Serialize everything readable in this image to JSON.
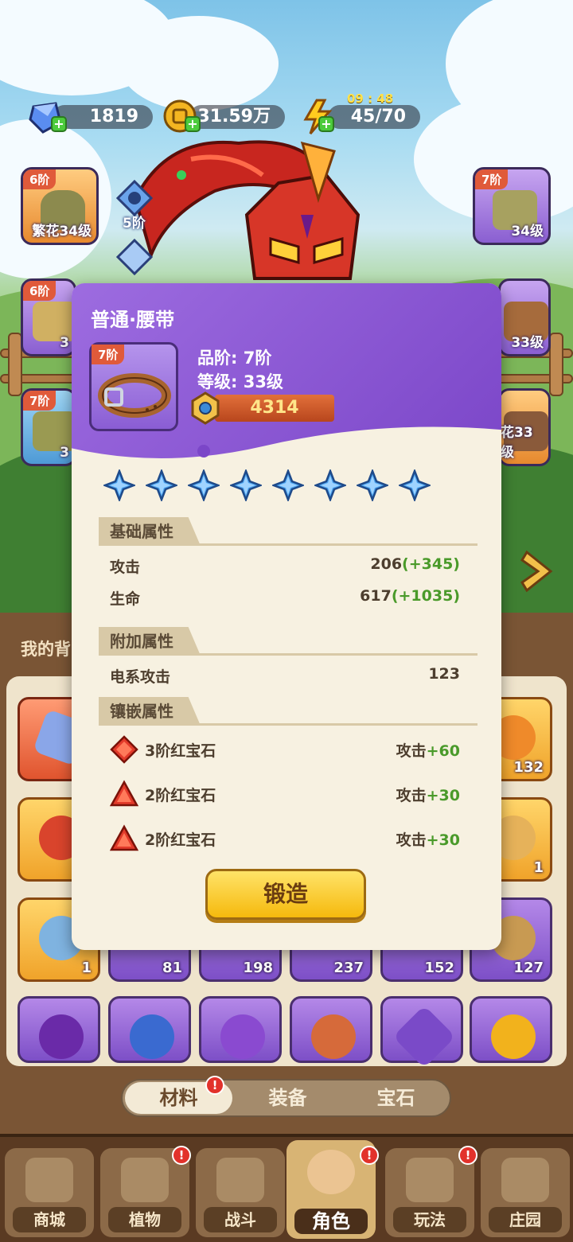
{
  "resources": {
    "diamonds": "1819",
    "gold": "31.59万",
    "energy": "45/70",
    "energy_timer": "09 : 48"
  },
  "equipment_slots": {
    "left_top": {
      "tier": "6阶",
      "level": "繁花34级"
    },
    "left_mid": {
      "tier": "6阶",
      "level": "3"
    },
    "left_bot": {
      "tier": "7阶",
      "level": "3"
    },
    "right_top": {
      "tier": "7阶",
      "level": "34级"
    },
    "right_mid": {
      "tier": "",
      "level": "33级"
    },
    "right_bot": {
      "tier": "",
      "level": "花33级"
    },
    "side_gem_level": "5阶"
  },
  "bag": {
    "title": "我的背",
    "counts": [
      "132",
      "1",
      "1",
      "81",
      "198",
      "237",
      "152",
      "127"
    ]
  },
  "tabs": [
    {
      "label": "材料",
      "badge": "!"
    },
    {
      "label": "装备",
      "badge": ""
    },
    {
      "label": "宝石",
      "badge": ""
    }
  ],
  "nav": [
    {
      "label": "商城",
      "badge": ""
    },
    {
      "label": "植物",
      "badge": "!"
    },
    {
      "label": "战斗",
      "badge": ""
    },
    {
      "label": "角色",
      "badge": "!"
    },
    {
      "label": "玩法",
      "badge": "!"
    },
    {
      "label": "庄园",
      "badge": ""
    }
  ],
  "popup": {
    "title": "普通·腰带",
    "tier_badge": "7阶",
    "quality_line": "品阶: 7阶",
    "level_line": "等级: 33级",
    "power": "4314",
    "star_count": 8,
    "base_section": "基础属性",
    "base_stats": [
      {
        "name": "攻击",
        "value": "206",
        "bonus": "(+345)"
      },
      {
        "name": "生命",
        "value": "617",
        "bonus": "(+1035)"
      }
    ],
    "extra_section": "附加属性",
    "extra_stats": [
      {
        "name": "电系攻击",
        "value": "123"
      }
    ],
    "inlay_section": "镶嵌属性",
    "gems": [
      {
        "name": "3阶红宝石",
        "stat": "攻击",
        "bonus": "+60",
        "shape": "diamond"
      },
      {
        "name": "2阶红宝石",
        "stat": "攻击",
        "bonus": "+30",
        "shape": "triangle"
      },
      {
        "name": "2阶红宝石",
        "stat": "攻击",
        "bonus": "+30",
        "shape": "triangle"
      }
    ],
    "forge_button": "锻造"
  },
  "colors": {
    "popup_header": "#8a57d6",
    "forge_button": "#f5c21a",
    "bonus_green": "#4a9a2a",
    "badge_red": "#e2322b"
  }
}
